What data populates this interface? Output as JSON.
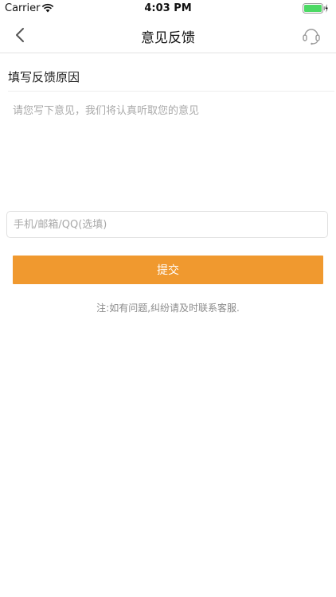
{
  "status_bar": {
    "carrier": "Carrier",
    "time": "4:03 PM",
    "battery_color": "#4cd964"
  },
  "nav": {
    "title": "意见反馈",
    "back_icon": "chevron-left-icon",
    "service_icon": "headset-icon"
  },
  "form": {
    "section_title": "填写反馈原因",
    "feedback_placeholder": "请您写下意见，我们将认真听取您的意见",
    "feedback_value": "",
    "contact_placeholder": "手机/邮箱/QQ(选填)",
    "contact_value": "",
    "submit_label": "提交"
  },
  "note": "注:如有问题,纠纷请及时联系客服.",
  "colors": {
    "accent": "#f0992f",
    "placeholder": "#a8a8a8"
  }
}
